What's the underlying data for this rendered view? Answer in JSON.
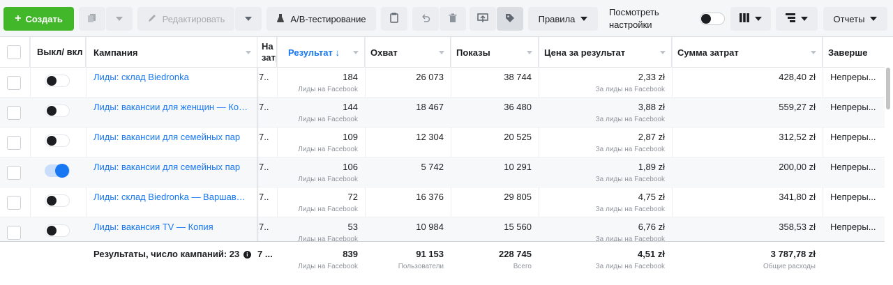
{
  "toolbar": {
    "create_label": "Создать",
    "edit_label": "Редактировать",
    "ab_label": "A/B-тестирование",
    "rules_label": "Правила",
    "view_settings_label": "Посмотреть настройки",
    "reports_label": "Отчеты"
  },
  "columns": {
    "toggle": "Выкл/ вкл",
    "campaign": "Кампания",
    "na": "На затр",
    "result": "Результат ↓",
    "reach": "Охват",
    "impressions": "Показы",
    "cpr": "Цена за результат",
    "spend": "Сумма затрат",
    "end": "Заверше"
  },
  "rows": [
    {
      "campaign": "Лиды: склад Biedronka",
      "na": "7..",
      "result": "184",
      "result_sub": "Лиды на Facebook",
      "reach": "26 073",
      "impressions": "38 744",
      "cpr": "2,33 zł",
      "cpr_sub": "За лиды на Facebook",
      "spend": "428,40 zł",
      "end": "Непреры...",
      "on": false
    },
    {
      "campaign": "Лиды: вакансии для женщин — Копия",
      "na": "7..",
      "result": "144",
      "result_sub": "Лиды на Facebook",
      "reach": "18 467",
      "impressions": "36 480",
      "cpr": "3,88 zł",
      "cpr_sub": "За лиды на Facebook",
      "spend": "559,27 zł",
      "end": "Непреры...",
      "on": false
    },
    {
      "campaign": "Лиды: вакансии для семейных пар",
      "na": "7..",
      "result": "109",
      "result_sub": "Лиды на Facebook",
      "reach": "12 304",
      "impressions": "20 525",
      "cpr": "2,87 zł",
      "cpr_sub": "За лиды на Facebook",
      "spend": "312,52 zł",
      "end": "Непреры...",
      "on": false
    },
    {
      "campaign": "Лиды: вакансии для семейных пар",
      "na": "7..",
      "result": "106",
      "result_sub": "Лиды на Facebook",
      "reach": "5 742",
      "impressions": "10 291",
      "cpr": "1,89 zł",
      "cpr_sub": "За лиды на Facebook",
      "spend": "200,00 zł",
      "end": "Непреры...",
      "on": true
    },
    {
      "campaign": "Лиды: склад Biedronka — Варшава ...",
      "na": "7..",
      "result": "72",
      "result_sub": "Лиды на Facebook",
      "reach": "16 376",
      "impressions": "29 805",
      "cpr": "4,75 zł",
      "cpr_sub": "За лиды на Facebook",
      "spend": "341,80 zł",
      "end": "Непреры...",
      "on": false
    },
    {
      "campaign": "Лиды: вакансия TV — Копия",
      "na": "7..",
      "result": "53",
      "result_sub": "Лиды на Facebook",
      "reach": "10 984",
      "impressions": "15 560",
      "cpr": "6,76 zł",
      "cpr_sub": "За лиды на Facebook",
      "spend": "358,53 zł",
      "end": "Непреры...",
      "on": false
    }
  ],
  "footer": {
    "label": "Результаты, число кампаний: 23",
    "na": "7 ...",
    "result": "839",
    "result_sub": "Лиды на Facebook",
    "reach": "91 153",
    "reach_sub": "Пользователи",
    "impressions": "228 745",
    "impressions_sub": "Всего",
    "cpr": "4,51 zł",
    "cpr_sub": "За лиды на Facebook",
    "spend": "3 787,78 zł",
    "spend_sub": "Общие расходы"
  },
  "colors": {
    "accent": "#1877f2",
    "create": "#42b72a"
  }
}
